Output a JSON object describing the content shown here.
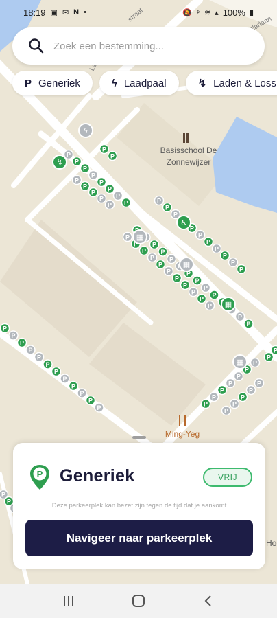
{
  "status_bar": {
    "time": "18:19",
    "left_icons": [
      "image-icon",
      "mail-icon",
      "n-icon",
      "dot-icon"
    ],
    "right_icons": [
      "mute-icon",
      "location-icon",
      "wifi-icon",
      "signal-icon"
    ],
    "battery": "100%"
  },
  "search": {
    "placeholder": "Zoek een bestemming...",
    "icon": "search-icon"
  },
  "chips": [
    {
      "label": "Generiek",
      "icon": "parking-p-icon"
    },
    {
      "label": "Laadpaal",
      "icon": "lightning-icon"
    },
    {
      "label": "Laden & Loss",
      "icon": "unloading-icon"
    }
  ],
  "map": {
    "labels": {
      "school": "Basisschool De Zonnewijzer",
      "restaurant": "Ming-Yeg",
      "street1": "Lan",
      "street2": "straat",
      "street3": "Solarlaan",
      "edge": "Hoo"
    },
    "colors": {
      "land": "#ece6d6",
      "road": "#ffffff",
      "water": "#aecbf0",
      "free_spot": "#2e9e4f",
      "occupied_spot": "#b3b8bd",
      "restaurant": "#b86a2d"
    }
  },
  "sheet": {
    "title": "Generiek",
    "status": "VRIJ",
    "note": "Deze parkeerplek kan bezet zijn tegen de tijd dat je aankomt",
    "button": "Navigeer naar parkeerplek",
    "accent": "#2e9e4f",
    "button_color": "#1d1d46"
  },
  "nav_bar": {
    "recents": "recents-icon",
    "home": "home-icon",
    "back": "back-icon"
  }
}
